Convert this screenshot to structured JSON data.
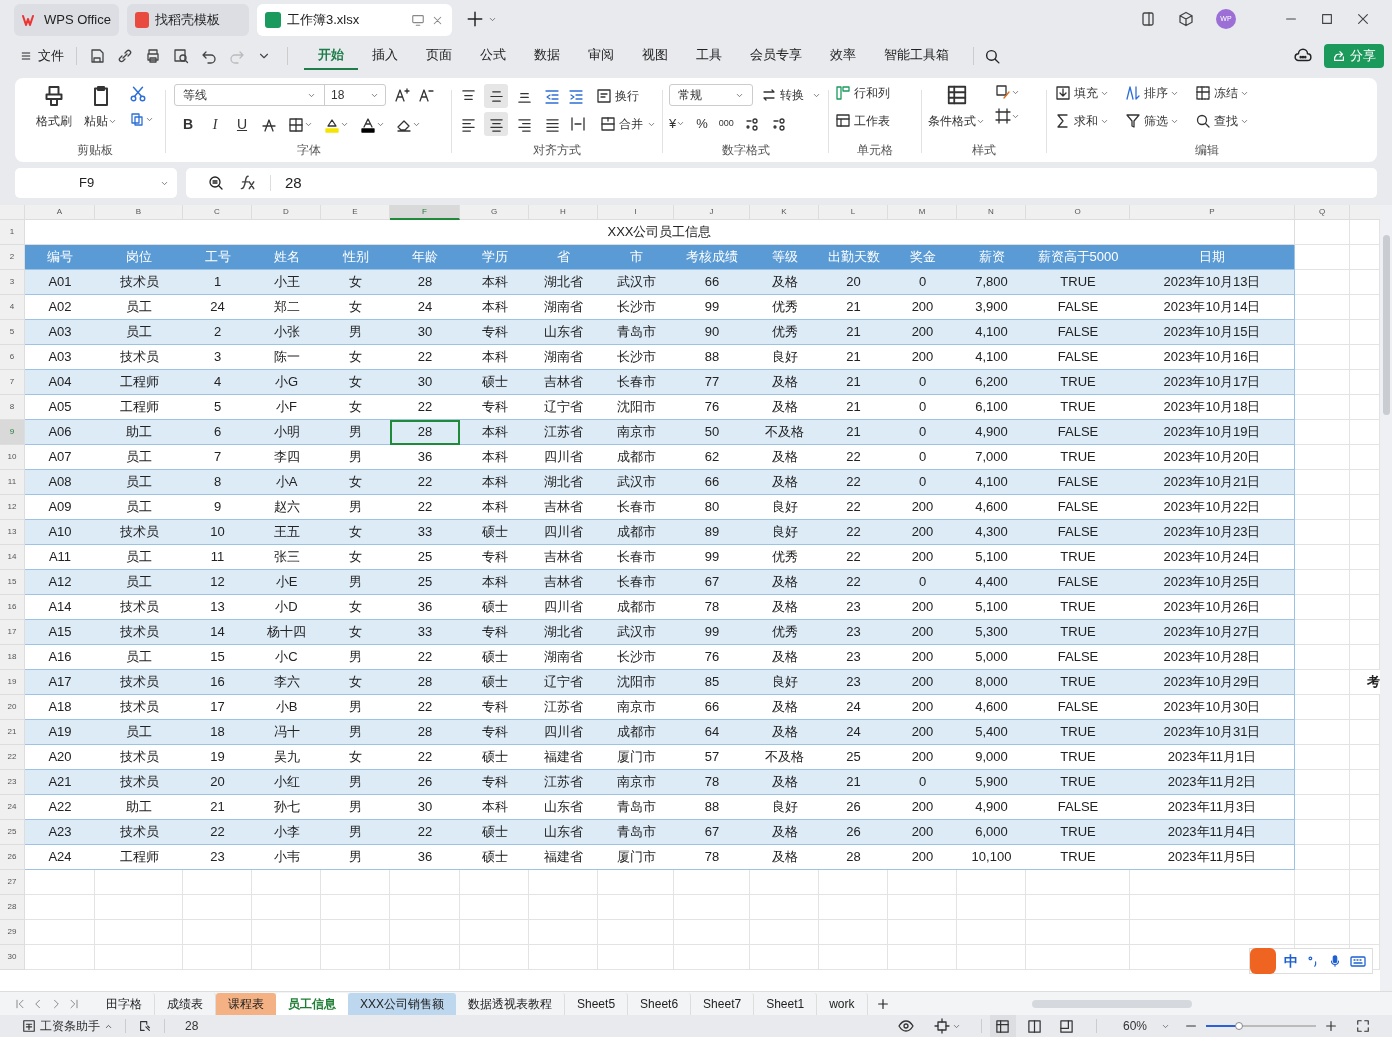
{
  "title_bar": {
    "tabs": [
      {
        "kind": "home",
        "label": "WPS Office",
        "selected": false
      },
      {
        "kind": "template",
        "label": "找稻壳模板",
        "selected": false
      },
      {
        "kind": "document",
        "label": "工作簿3.xlsx",
        "selected": true
      }
    ],
    "avatar": "WP"
  },
  "menu": {
    "file": "文件",
    "tabs": [
      {
        "label": "开始",
        "selected": true
      },
      {
        "label": "插入",
        "selected": false
      },
      {
        "label": "页面",
        "selected": false
      },
      {
        "label": "公式",
        "selected": false
      },
      {
        "label": "数据",
        "selected": false
      },
      {
        "label": "审阅",
        "selected": false
      },
      {
        "label": "视图",
        "selected": false
      },
      {
        "label": "工具",
        "selected": false
      },
      {
        "label": "会员专享",
        "selected": false
      },
      {
        "label": "效率",
        "selected": false
      },
      {
        "label": "智能工具箱",
        "selected": false
      }
    ],
    "share": "分享"
  },
  "ribbon": {
    "clipboard": {
      "title": "剪贴板",
      "format_painter": "格式刷",
      "paste": "粘贴"
    },
    "font": {
      "title": "字体",
      "font_name": "等线",
      "font_size": "18",
      "style_buttons": [
        "B",
        "I",
        "U"
      ]
    },
    "alignment": {
      "title": "对齐方式",
      "wrap": "换行",
      "merge": "合并",
      "vertical": [
        {
          "selected": false
        },
        {
          "selected": true
        },
        {
          "selected": false
        }
      ],
      "horizontal": [
        {
          "selected": false
        },
        {
          "selected": true
        },
        {
          "selected": false
        },
        {
          "selected": false
        }
      ]
    },
    "number": {
      "title": "数字格式",
      "format": "常规",
      "convert": "转换",
      "currency": "¥",
      "percent": "%",
      "thousands": "000"
    },
    "cells": {
      "title": "单元格",
      "rows_columns": "行和列",
      "worksheet": "工作表"
    },
    "styles": {
      "title": "样式",
      "conditional_format": "条件格式"
    },
    "editing": {
      "title": "编辑",
      "fill": "填充",
      "sort": "排序",
      "freeze": "冻结",
      "sum": "求和",
      "filter": "筛选",
      "find": "查找"
    }
  },
  "formula_bar": {
    "name_box": "F9",
    "value": "28"
  },
  "sheet": {
    "columns": [
      {
        "label": "A",
        "selected": false
      },
      {
        "label": "B",
        "selected": false
      },
      {
        "label": "C",
        "selected": false
      },
      {
        "label": "D",
        "selected": false
      },
      {
        "label": "E",
        "selected": false
      },
      {
        "label": "F",
        "selected": true
      },
      {
        "label": "G",
        "selected": false
      },
      {
        "label": "H",
        "selected": false
      },
      {
        "label": "I",
        "selected": false
      },
      {
        "label": "J",
        "selected": false
      },
      {
        "label": "K",
        "selected": false
      },
      {
        "label": "L",
        "selected": false
      },
      {
        "label": "M",
        "selected": false
      },
      {
        "label": "N",
        "selected": false
      },
      {
        "label": "O",
        "selected": false
      },
      {
        "label": "P",
        "selected": false
      },
      {
        "label": "Q",
        "selected": false
      }
    ],
    "row_numbers": [
      {
        "label": "1",
        "selected": false
      },
      {
        "label": "2",
        "selected": false
      },
      {
        "label": "3",
        "selected": false
      },
      {
        "label": "4",
        "selected": false
      },
      {
        "label": "5",
        "selected": false
      },
      {
        "label": "6",
        "selected": false
      },
      {
        "label": "7",
        "selected": false
      },
      {
        "label": "8",
        "selected": false
      },
      {
        "label": "9",
        "selected": true
      },
      {
        "label": "10",
        "selected": false
      },
      {
        "label": "11",
        "selected": false
      },
      {
        "label": "12",
        "selected": false
      },
      {
        "label": "13",
        "selected": false
      },
      {
        "label": "14",
        "selected": false
      },
      {
        "label": "15",
        "selected": false
      },
      {
        "label": "16",
        "selected": false
      },
      {
        "label": "17",
        "selected": false
      },
      {
        "label": "18",
        "selected": false
      },
      {
        "label": "19",
        "selected": false
      },
      {
        "label": "20",
        "selected": false
      },
      {
        "label": "21",
        "selected": false
      },
      {
        "label": "22",
        "selected": false
      },
      {
        "label": "23",
        "selected": false
      },
      {
        "label": "24",
        "selected": false
      },
      {
        "label": "25",
        "selected": false
      },
      {
        "label": "26",
        "selected": false
      },
      {
        "label": "27",
        "selected": false
      },
      {
        "label": "28",
        "selected": false
      },
      {
        "label": "29",
        "selected": false
      },
      {
        "label": "30",
        "selected": false
      }
    ],
    "title": "XXX公司员工信息",
    "headers": [
      "编号",
      "岗位",
      "工号",
      "姓名",
      "性别",
      "年龄",
      "学历",
      "省",
      "市",
      "考核成绩",
      "等级",
      "出勤天数",
      "奖金",
      "薪资",
      "薪资高于5000",
      "日期"
    ],
    "rows": [
      {
        "cells": [
          "A01",
          "技术员",
          "1",
          "小王",
          "女",
          "28",
          "本科",
          "湖北省",
          "武汉市",
          "66",
          "及格",
          "20",
          "0",
          "7,800",
          "TRUE",
          "2023年10月13日"
        ]
      },
      {
        "cells": [
          "A02",
          "员工",
          "24",
          "郑二",
          "女",
          "24",
          "本科",
          "湖南省",
          "长沙市",
          "99",
          "优秀",
          "21",
          "200",
          "3,900",
          "FALSE",
          "2023年10月14日"
        ]
      },
      {
        "cells": [
          "A03",
          "员工",
          "2",
          "小张",
          "男",
          "30",
          "专科",
          "山东省",
          "青岛市",
          "90",
          "优秀",
          "21",
          "200",
          "4,100",
          "FALSE",
          "2023年10月15日"
        ]
      },
      {
        "cells": [
          "A03",
          "技术员",
          "3",
          "陈一",
          "女",
          "22",
          "本科",
          "湖南省",
          "长沙市",
          "88",
          "良好",
          "21",
          "200",
          "4,100",
          "FALSE",
          "2023年10月16日"
        ]
      },
      {
        "cells": [
          "A04",
          "工程师",
          "4",
          "小G",
          "女",
          "30",
          "硕士",
          "吉林省",
          "长春市",
          "77",
          "及格",
          "21",
          "0",
          "6,200",
          "TRUE",
          "2023年10月17日"
        ]
      },
      {
        "cells": [
          "A05",
          "工程师",
          "5",
          "小F",
          "女",
          "22",
          "专科",
          "辽宁省",
          "沈阳市",
          "76",
          "及格",
          "21",
          "0",
          "6,100",
          "TRUE",
          "2023年10月18日"
        ]
      },
      {
        "cells": [
          "A06",
          "助工",
          "6",
          "小明",
          "男",
          "28",
          "本科",
          "江苏省",
          "南京市",
          "50",
          "不及格",
          "21",
          "0",
          "4,900",
          "FALSE",
          "2023年10月19日"
        ]
      },
      {
        "cells": [
          "A07",
          "员工",
          "7",
          "李四",
          "男",
          "36",
          "本科",
          "四川省",
          "成都市",
          "62",
          "及格",
          "22",
          "0",
          "7,000",
          "TRUE",
          "2023年10月20日"
        ]
      },
      {
        "cells": [
          "A08",
          "员工",
          "8",
          "小A",
          "女",
          "22",
          "本科",
          "湖北省",
          "武汉市",
          "66",
          "及格",
          "22",
          "0",
          "4,100",
          "FALSE",
          "2023年10月21日"
        ]
      },
      {
        "cells": [
          "A09",
          "员工",
          "9",
          "赵六",
          "男",
          "22",
          "本科",
          "吉林省",
          "长春市",
          "80",
          "良好",
          "22",
          "200",
          "4,600",
          "FALSE",
          "2023年10月22日"
        ]
      },
      {
        "cells": [
          "A10",
          "技术员",
          "10",
          "王五",
          "女",
          "33",
          "硕士",
          "四川省",
          "成都市",
          "89",
          "良好",
          "22",
          "200",
          "4,300",
          "FALSE",
          "2023年10月23日"
        ]
      },
      {
        "cells": [
          "A11",
          "员工",
          "11",
          "张三",
          "女",
          "25",
          "专科",
          "吉林省",
          "长春市",
          "99",
          "优秀",
          "22",
          "200",
          "5,100",
          "TRUE",
          "2023年10月24日"
        ]
      },
      {
        "cells": [
          "A12",
          "员工",
          "12",
          "小E",
          "男",
          "25",
          "本科",
          "吉林省",
          "长春市",
          "67",
          "及格",
          "22",
          "0",
          "4,400",
          "FALSE",
          "2023年10月25日"
        ]
      },
      {
        "cells": [
          "A14",
          "技术员",
          "13",
          "小D",
          "女",
          "36",
          "硕士",
          "四川省",
          "成都市",
          "78",
          "及格",
          "23",
          "200",
          "5,100",
          "TRUE",
          "2023年10月26日"
        ]
      },
      {
        "cells": [
          "A15",
          "技术员",
          "14",
          "杨十四",
          "女",
          "33",
          "专科",
          "湖北省",
          "武汉市",
          "99",
          "优秀",
          "23",
          "200",
          "5,300",
          "TRUE",
          "2023年10月27日"
        ]
      },
      {
        "cells": [
          "A16",
          "员工",
          "15",
          "小C",
          "男",
          "22",
          "硕士",
          "湖南省",
          "长沙市",
          "76",
          "及格",
          "23",
          "200",
          "5,000",
          "FALSE",
          "2023年10月28日"
        ]
      },
      {
        "cells": [
          "A17",
          "技术员",
          "16",
          "李六",
          "女",
          "28",
          "硕士",
          "辽宁省",
          "沈阳市",
          "85",
          "良好",
          "23",
          "200",
          "8,000",
          "TRUE",
          "2023年10月29日"
        ],
        "column_r": "考"
      },
      {
        "cells": [
          "A18",
          "技术员",
          "17",
          "小B",
          "男",
          "22",
          "专科",
          "江苏省",
          "南京市",
          "66",
          "及格",
          "24",
          "200",
          "4,600",
          "FALSE",
          "2023年10月30日"
        ]
      },
      {
        "cells": [
          "A19",
          "员工",
          "18",
          "冯十",
          "男",
          "28",
          "专科",
          "四川省",
          "成都市",
          "64",
          "及格",
          "24",
          "200",
          "5,400",
          "TRUE",
          "2023年10月31日"
        ]
      },
      {
        "cells": [
          "A20",
          "技术员",
          "19",
          "吴九",
          "女",
          "22",
          "硕士",
          "福建省",
          "厦门市",
          "57",
          "不及格",
          "25",
          "200",
          "9,000",
          "TRUE",
          "2023年11月1日"
        ]
      },
      {
        "cells": [
          "A21",
          "技术员",
          "20",
          "小红",
          "男",
          "26",
          "专科",
          "江苏省",
          "南京市",
          "78",
          "及格",
          "21",
          "0",
          "5,900",
          "TRUE",
          "2023年11月2日"
        ]
      },
      {
        "cells": [
          "A22",
          "助工",
          "21",
          "孙七",
          "男",
          "30",
          "本科",
          "山东省",
          "青岛市",
          "88",
          "良好",
          "26",
          "200",
          "4,900",
          "FALSE",
          "2023年11月3日"
        ]
      },
      {
        "cells": [
          "A23",
          "技术员",
          "22",
          "小李",
          "男",
          "22",
          "硕士",
          "山东省",
          "青岛市",
          "67",
          "及格",
          "26",
          "200",
          "6,000",
          "TRUE",
          "2023年11月4日"
        ]
      },
      {
        "cells": [
          "A24",
          "工程师",
          "23",
          "小韦",
          "男",
          "36",
          "硕士",
          "福建省",
          "厦门市",
          "78",
          "及格",
          "28",
          "200",
          "10,100",
          "TRUE",
          "2023年11月5日"
        ]
      }
    ]
  },
  "sheet_tabs": [
    {
      "label": "田字格",
      "selected": false
    },
    {
      "label": "成绩表",
      "selected": false
    },
    {
      "label": "课程表",
      "selected": false,
      "color": "#f4b183"
    },
    {
      "label": "员工信息",
      "selected": true
    },
    {
      "label": "XXX公司销售额",
      "selected": false,
      "color": "#bdd7ee"
    },
    {
      "label": "数据透视表教程",
      "selected": false
    },
    {
      "label": "Sheet5",
      "selected": false
    },
    {
      "label": "Sheet6",
      "selected": false
    },
    {
      "label": "Sheet7",
      "selected": false
    },
    {
      "label": "Sheet1",
      "selected": false
    },
    {
      "label": "work",
      "selected": false
    }
  ],
  "status_bar": {
    "assistant": "工资条助手",
    "cell_value": "28",
    "zoom": "60%",
    "zoom_slider": {
      "level": 0.3
    },
    "views": [
      {
        "selected": true
      },
      {
        "selected": false
      },
      {
        "selected": false
      }
    ]
  },
  "ime_bar": {
    "mode": "中"
  }
}
